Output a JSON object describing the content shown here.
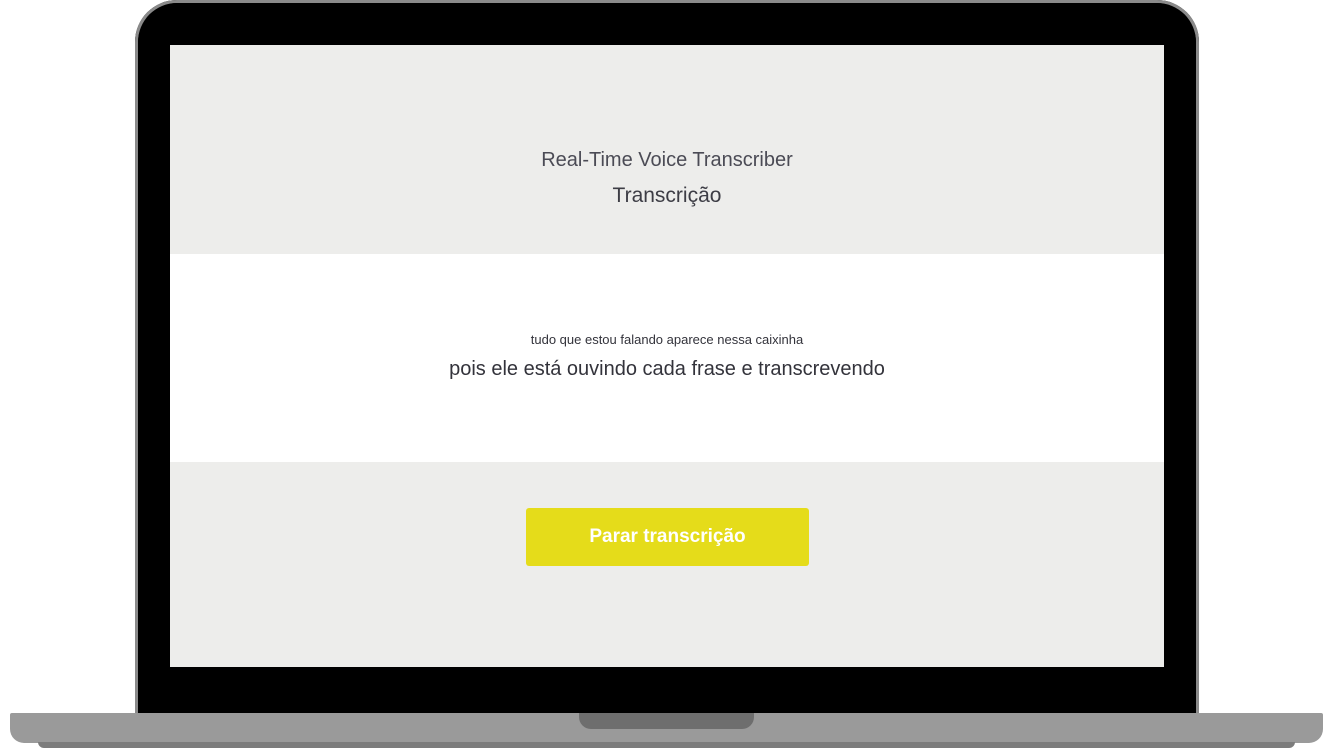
{
  "app": {
    "title": "Real-Time Voice Transcriber",
    "subtitle": "Transcrição"
  },
  "transcript": {
    "lines": [
      "tudo que estou falando aparece nessa caixinha",
      "pois ele está ouvindo cada frase e transcrevendo"
    ]
  },
  "controls": {
    "stop_label": "Parar transcrição"
  },
  "colors": {
    "accent": "#e5dc1a",
    "panel_background": "#ededeb",
    "transcript_background": "#ffffff",
    "text": "#3d3d45"
  }
}
